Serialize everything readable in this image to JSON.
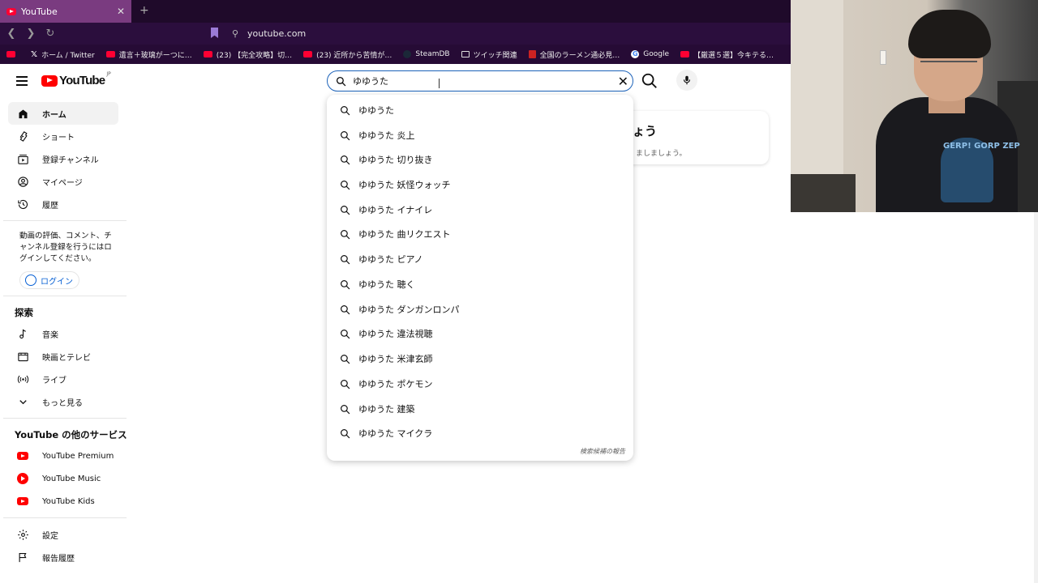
{
  "browser": {
    "tab_title": "YouTube",
    "new_tab": "+",
    "close_tab": "✕",
    "url": "youtube.com",
    "bookmarks": [
      {
        "label": "",
        "icon": "youtube-icon"
      },
      {
        "label": "ホーム / Twitter",
        "icon": "x-icon"
      },
      {
        "label": "遺言＋玻璃がーつに…",
        "icon": "image-icon"
      },
      {
        "label": "(23) 【完全攻略】切…",
        "icon": "youtube-icon"
      },
      {
        "label": "(23) 近所から苦情が…",
        "icon": "youtube-icon"
      },
      {
        "label": "SteamDB",
        "icon": "steam-icon"
      },
      {
        "label": "ツイッチ関連",
        "icon": "folder-icon"
      },
      {
        "label": "全国のラーメン通必見…",
        "icon": "ramen-icon"
      },
      {
        "label": "Google",
        "icon": "google-icon"
      },
      {
        "label": "【厳選５選】今キテる…",
        "icon": "youtube-icon"
      }
    ]
  },
  "header": {
    "logo_text": "YouTube",
    "logo_region": "JP",
    "search_value": "ゆゆうた"
  },
  "sidebar": {
    "main_items": [
      {
        "label": "ホーム",
        "icon": "home-icon",
        "active": true
      },
      {
        "label": "ショート",
        "icon": "shorts-icon"
      },
      {
        "label": "登録チャンネル",
        "icon": "subscriptions-icon"
      },
      {
        "label": "マイページ",
        "icon": "account-icon"
      },
      {
        "label": "履歴",
        "icon": "history-icon"
      }
    ],
    "login_prompt": "動画の評価、コメント、チャンネル登録を行うにはログインしてください。",
    "login_button": "ログイン",
    "explore_heading": "探索",
    "explore_items": [
      {
        "label": "音楽",
        "icon": "music-icon"
      },
      {
        "label": "映画とテレビ",
        "icon": "film-icon"
      },
      {
        "label": "ライブ",
        "icon": "live-icon"
      },
      {
        "label": "もっと見る",
        "icon": "chevron-down-icon"
      }
    ],
    "services_heading": "YouTube の他のサービス",
    "service_items": [
      {
        "label": "YouTube Premium",
        "icon": "youtube-premium-icon"
      },
      {
        "label": "YouTube Music",
        "icon": "youtube-music-icon"
      },
      {
        "label": "YouTube Kids",
        "icon": "youtube-kids-icon"
      }
    ],
    "bottom_items": [
      {
        "label": "設定",
        "icon": "settings-icon"
      },
      {
        "label": "報告履歴",
        "icon": "flag-icon"
      }
    ]
  },
  "background_card": {
    "title": "ょう",
    "subtext": "ましましょう。"
  },
  "suggestions": [
    "ゆゆうた",
    "ゆゆうた 炎上",
    "ゆゆうた 切り抜き",
    "ゆゆうた 妖怪ウォッチ",
    "ゆゆうた イナイレ",
    "ゆゆうた 曲リクエスト",
    "ゆゆうた ピアノ",
    "ゆゆうた 聴く",
    "ゆゆうた ダンガンロンパ",
    "ゆゆうた 違法視聴",
    "ゆゆうた 米津玄師",
    "ゆゆうた ポケモン",
    "ゆゆうた 建築",
    "ゆゆうた マイクラ"
  ],
  "report_link": "検索候補の報告",
  "webcam": {
    "shirt_text": "GERP! GORP ZEP"
  },
  "colors": {
    "accent": "#ff0000",
    "link": "#065fd4",
    "browser_bg": "#260b35",
    "tab_active": "#7a3b80"
  }
}
